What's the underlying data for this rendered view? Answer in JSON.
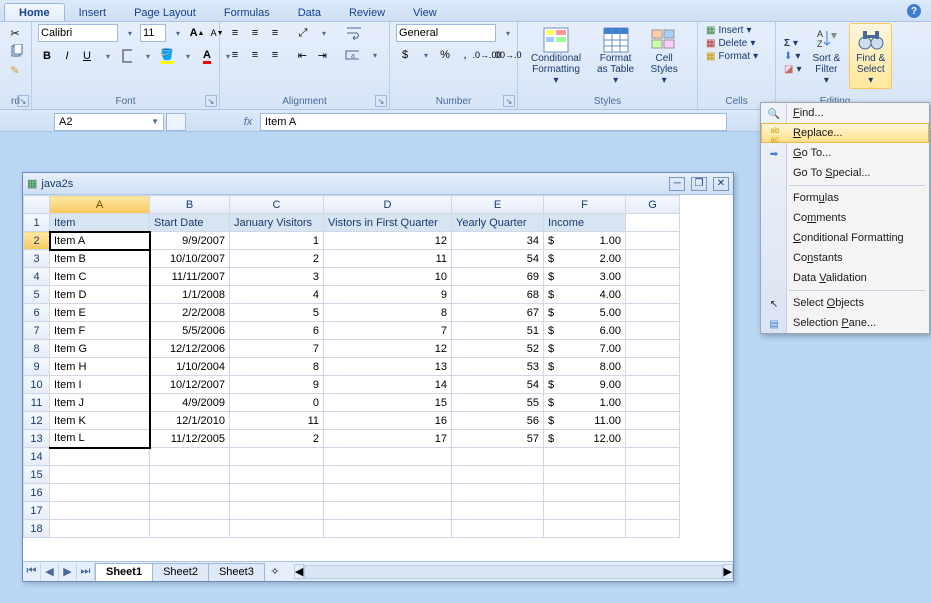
{
  "tabs": [
    "Home",
    "Insert",
    "Page Layout",
    "Formulas",
    "Data",
    "Review",
    "View"
  ],
  "active_tab": 0,
  "ribbon": {
    "clipboard_label": "rd",
    "font_label": "Font",
    "alignment_label": "Alignment",
    "number_label": "Number",
    "styles_label": "Styles",
    "cells_label": "Cells",
    "editing_label": "Editing",
    "font_name": "Calibri",
    "font_size": "11",
    "number_format": "General",
    "cond_fmt": "Conditional\nFormatting",
    "fmt_table": "Format\nas Table",
    "cell_styles": "Cell\nStyles",
    "insert": "Insert",
    "delete": "Delete",
    "format": "Format",
    "sort_filter": "Sort &\nFilter",
    "find_select": "Find &\nSelect"
  },
  "namebox": "A2",
  "formula": "Item A",
  "doc_title": "java2s",
  "columns": [
    "A",
    "B",
    "C",
    "D",
    "E",
    "F",
    "G"
  ],
  "headers": [
    "Item",
    "Start Date",
    "January Visitors",
    "Vistors in First Quarter",
    "Yearly Quarter",
    "Income"
  ],
  "rows": [
    {
      "item": "Item A",
      "date": "9/9/2007",
      "jan": "1",
      "q1": "12",
      "yq": "34",
      "cur": "$",
      "inc": "1.00"
    },
    {
      "item": "Item B",
      "date": "10/10/2007",
      "jan": "2",
      "q1": "11",
      "yq": "54",
      "cur": "$",
      "inc": "2.00"
    },
    {
      "item": "Item C",
      "date": "11/11/2007",
      "jan": "3",
      "q1": "10",
      "yq": "69",
      "cur": "$",
      "inc": "3.00"
    },
    {
      "item": "Item D",
      "date": "1/1/2008",
      "jan": "4",
      "q1": "9",
      "yq": "68",
      "cur": "$",
      "inc": "4.00"
    },
    {
      "item": "Item E",
      "date": "2/2/2008",
      "jan": "5",
      "q1": "8",
      "yq": "67",
      "cur": "$",
      "inc": "5.00"
    },
    {
      "item": "Item F",
      "date": "5/5/2006",
      "jan": "6",
      "q1": "7",
      "yq": "51",
      "cur": "$",
      "inc": "6.00"
    },
    {
      "item": "Item G",
      "date": "12/12/2006",
      "jan": "7",
      "q1": "12",
      "yq": "52",
      "cur": "$",
      "inc": "7.00"
    },
    {
      "item": "Item H",
      "date": "1/10/2004",
      "jan": "8",
      "q1": "13",
      "yq": "53",
      "cur": "$",
      "inc": "8.00"
    },
    {
      "item": "Item I",
      "date": "10/12/2007",
      "jan": "9",
      "q1": "14",
      "yq": "54",
      "cur": "$",
      "inc": "9.00"
    },
    {
      "item": "Item J",
      "date": "4/9/2009",
      "jan": "0",
      "q1": "15",
      "yq": "55",
      "cur": "$",
      "inc": "1.00"
    },
    {
      "item": "Item K",
      "date": "12/1/2010",
      "jan": "11",
      "q1": "16",
      "yq": "56",
      "cur": "$",
      "inc": "11.00"
    },
    {
      "item": "Item L",
      "date": "11/12/2005",
      "jan": "2",
      "q1": "17",
      "yq": "57",
      "cur": "$",
      "inc": "12.00"
    }
  ],
  "sheets": [
    "Sheet1",
    "Sheet2",
    "Sheet3"
  ],
  "active_sheet": 0,
  "dropdown": {
    "find": "Find...",
    "replace": "Replace...",
    "goto": "Go To...",
    "gotospecial": "Go To Special...",
    "formulas": "Formulas",
    "comments": "Comments",
    "condfmt": "Conditional Formatting",
    "constants": "Constants",
    "datavalid": "Data Validation",
    "selobj": "Select Objects",
    "selpane": "Selection Pane..."
  }
}
